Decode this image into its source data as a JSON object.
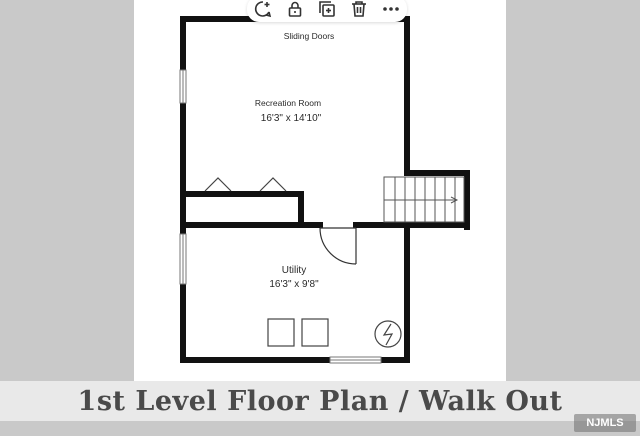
{
  "plan": {
    "top_label": "Sliding Doors",
    "rooms": [
      {
        "name": "Recreation Room",
        "size": "16'3\" x 14'10\""
      },
      {
        "name": "Utility",
        "size": "16'3\" x 9'8\""
      }
    ]
  },
  "caption": "1st Level Floor Plan / Walk Out",
  "toolbar": {
    "icons": [
      "comment-add-icon",
      "lock-icon",
      "duplicate-icon",
      "trash-icon",
      "more-icon"
    ]
  },
  "watermark": "NJMLS",
  "colors": {
    "wall": "#111111",
    "background": "#c9c9c9",
    "page": "#ffffff"
  }
}
